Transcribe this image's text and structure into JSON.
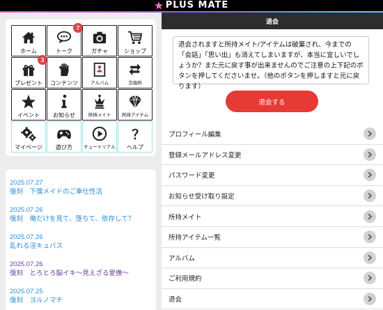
{
  "header": {
    "logo_text": "PLUS MATE"
  },
  "menu": {
    "items": [
      {
        "label": "ホーム",
        "icon": "home-icon"
      },
      {
        "label": "トーク",
        "icon": "chat-icon",
        "badge": "7"
      },
      {
        "label": "ガチャ",
        "icon": "camera-icon"
      },
      {
        "label": "ショップ",
        "icon": "cart-icon"
      },
      {
        "label": "プレゼント",
        "icon": "gift-icon",
        "badge": "3"
      },
      {
        "label": "コンテンツ",
        "icon": "glove-icon"
      },
      {
        "label": "アルバム",
        "icon": "album-icon"
      },
      {
        "label": "交換所",
        "icon": "exchange-icon"
      },
      {
        "label": "イベント",
        "icon": "star-icon"
      },
      {
        "label": "お知らせ",
        "icon": "info-icon"
      },
      {
        "label": "所持メイト",
        "icon": "chess-queen-icon"
      },
      {
        "label": "所持アイテム",
        "icon": "diamond-icon"
      },
      {
        "label": "マイページ",
        "icon": "gears-icon"
      },
      {
        "label": "遊び方",
        "icon": "gamepad-icon"
      },
      {
        "label": "チュートリアル",
        "icon": "play-icon"
      },
      {
        "label": "ヘルプ",
        "icon": "question-icon"
      }
    ]
  },
  "news": [
    {
      "date": "2025.07.27",
      "title": "復刻　下僕メイドのご奉仕性活"
    },
    {
      "date": "2025.07.26",
      "title": "復刻　俺だけを見て、堕ちて、依存して？"
    },
    {
      "date": "2025.07.26",
      "title": "乱れる淫キュバス"
    },
    {
      "date": "2025.07.26",
      "title": "復刻　とろとろ脳イキ〜見えざる愛撫〜"
    },
    {
      "date": "2025.07.25",
      "title": "復刻　ヨルノマチ"
    }
  ],
  "panel": {
    "title": "退会",
    "notice": "退会されますと所持メイト/アイテムは破棄され、今までの「会話」「思い出」も消えてしまいますが、本当に宜しいでしょうか？また元に戻す事が出来ませんのでご注意の上下記のボタンを押してくださいませ。（他のボタンを押しますと元に戻ります）",
    "withdraw_button": "退会する",
    "menu": [
      "プロフィール編集",
      "登録メールアドレス変更",
      "パスワード変更",
      "お知らせ受け取り設定",
      "所持メイト",
      "所持アイテム一覧",
      "アルバム",
      "ご利用規約",
      "退会"
    ]
  },
  "colors": {
    "accent_red": "#e53a35",
    "badge_red": "#e0434b",
    "link_blue": "#2a8ed6",
    "link_visited": "#6b3fa0",
    "panel_header": "#2d2d2d"
  }
}
